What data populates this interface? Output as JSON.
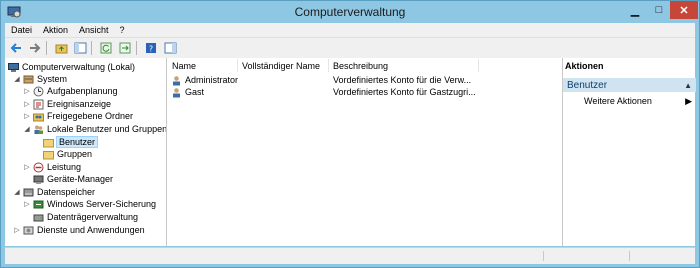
{
  "window": {
    "title": "Computerverwaltung"
  },
  "menu": [
    {
      "label": "Datei"
    },
    {
      "label": "Aktion"
    },
    {
      "label": "Ansicht"
    },
    {
      "label": "?"
    }
  ],
  "tree": [
    {
      "label": "Computerverwaltung (Lokal)"
    },
    {
      "label": "System"
    },
    {
      "label": "Aufgabenplanung"
    },
    {
      "label": "Ereignisanzeige"
    },
    {
      "label": "Freigegebene Ordner"
    },
    {
      "label": "Lokale Benutzer und Gruppen"
    },
    {
      "label": "Benutzer"
    },
    {
      "label": "Gruppen"
    },
    {
      "label": "Leistung"
    },
    {
      "label": "Geräte-Manager"
    },
    {
      "label": "Datenspeicher"
    },
    {
      "label": "Windows Server-Sicherung"
    },
    {
      "label": "Datenträgerverwaltung"
    },
    {
      "label": "Dienste und Anwendungen"
    }
  ],
  "list": {
    "columns": [
      "Name",
      "Vollständiger Name",
      "Beschreibung"
    ],
    "rows": [
      {
        "name": "Administrator",
        "fullname": "",
        "description": "Vordefiniertes Konto für die Verw..."
      },
      {
        "name": "Gast",
        "fullname": "",
        "description": "Vordefiniertes Konto für Gastzugri..."
      }
    ]
  },
  "actions": {
    "header": "Aktionen",
    "section": "Benutzer",
    "item": "Weitere Aktionen"
  }
}
